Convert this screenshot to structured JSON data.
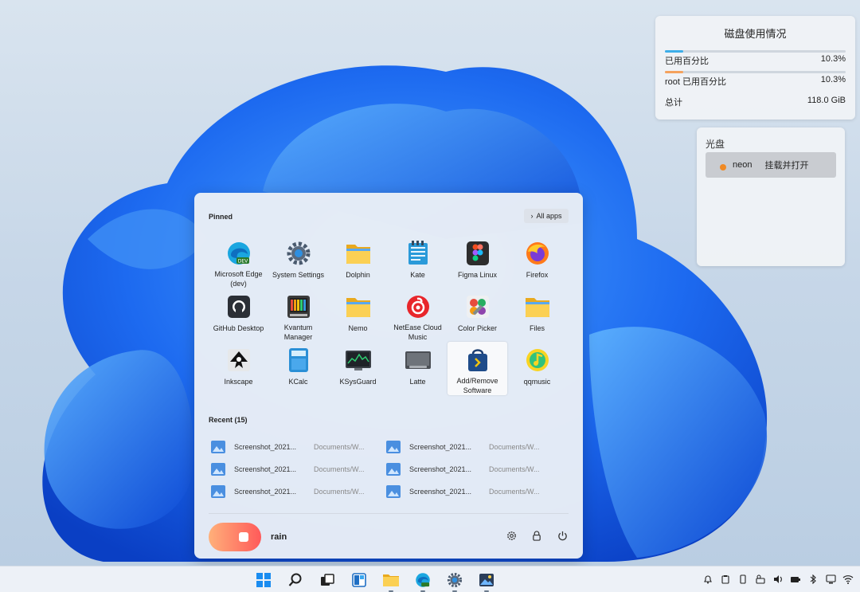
{
  "widgets": {
    "disk": {
      "title": "磁盘使用情况",
      "rows": [
        {
          "label": "已用百分比",
          "value": "10.3%",
          "fill": 0.103,
          "color": "#3daee9"
        },
        {
          "label": "root 已用百分比",
          "value": "10.3%",
          "fill": 0.103,
          "color": "#f5a25d"
        },
        {
          "label": "总计",
          "value": "118.0 GiB"
        }
      ]
    },
    "optical": {
      "title": "光盘",
      "device": "neon",
      "action": "挂载并打开"
    }
  },
  "start_menu": {
    "pinned_label": "Pinned",
    "all_apps_label": "All apps",
    "apps": [
      {
        "label": "Microsoft Edge (dev)",
        "icon": "edge-dev-icon"
      },
      {
        "label": "System Settings",
        "icon": "settings-gear-icon"
      },
      {
        "label": "Dolphin",
        "icon": "folder-icon"
      },
      {
        "label": "Kate",
        "icon": "notepad-icon"
      },
      {
        "label": "Figma Linux",
        "icon": "figma-icon"
      },
      {
        "label": "Firefox",
        "icon": "firefox-icon"
      },
      {
        "label": "GitHub Desktop",
        "icon": "github-icon"
      },
      {
        "label": "Kvantum Manager",
        "icon": "kvantum-icon"
      },
      {
        "label": "Nemo",
        "icon": "folder-icon"
      },
      {
        "label": "NetEase Cloud Music",
        "icon": "netease-music-icon"
      },
      {
        "label": "Color Picker",
        "icon": "color-picker-icon"
      },
      {
        "label": "Files",
        "icon": "folder-icon"
      },
      {
        "label": "Inkscape",
        "icon": "inkscape-icon"
      },
      {
        "label": "KCalc",
        "icon": "calculator-icon"
      },
      {
        "label": "KSysGuard",
        "icon": "system-monitor-icon"
      },
      {
        "label": "Latte",
        "icon": "latte-dock-icon"
      },
      {
        "label": "Add/Remove Software",
        "icon": "software-store-icon"
      },
      {
        "label": "qqmusic",
        "icon": "qqmusic-icon"
      }
    ],
    "recent_label": "Recent (15)",
    "recent": [
      {
        "name": "Screenshot_2021...",
        "path": "Documents/W..."
      },
      {
        "name": "Screenshot_2021...",
        "path": "Documents/W..."
      },
      {
        "name": "Screenshot_2021...",
        "path": "Documents/W..."
      },
      {
        "name": "Screenshot_2021...",
        "path": "Documents/W..."
      },
      {
        "name": "Screenshot_2021...",
        "path": "Documents/W..."
      },
      {
        "name": "Screenshot_2021...",
        "path": "Documents/W..."
      }
    ],
    "user_name": "rain"
  },
  "taskbar": {
    "apps": [
      "start-icon",
      "search-icon",
      "task-view-icon",
      "widgets-icon",
      "file-explorer-icon",
      "edge-dev-icon",
      "settings-gear-icon",
      "photos-icon"
    ],
    "tray": [
      "notification-icon",
      "clipboard-icon",
      "device-icon",
      "keyboard-layout-icon",
      "volume-icon",
      "battery-icon",
      "bluetooth-icon",
      "display-icon",
      "wifi-icon"
    ]
  },
  "colors": {
    "accent": "#3daee9",
    "wallpaper_blue": "#1a5fe8"
  }
}
